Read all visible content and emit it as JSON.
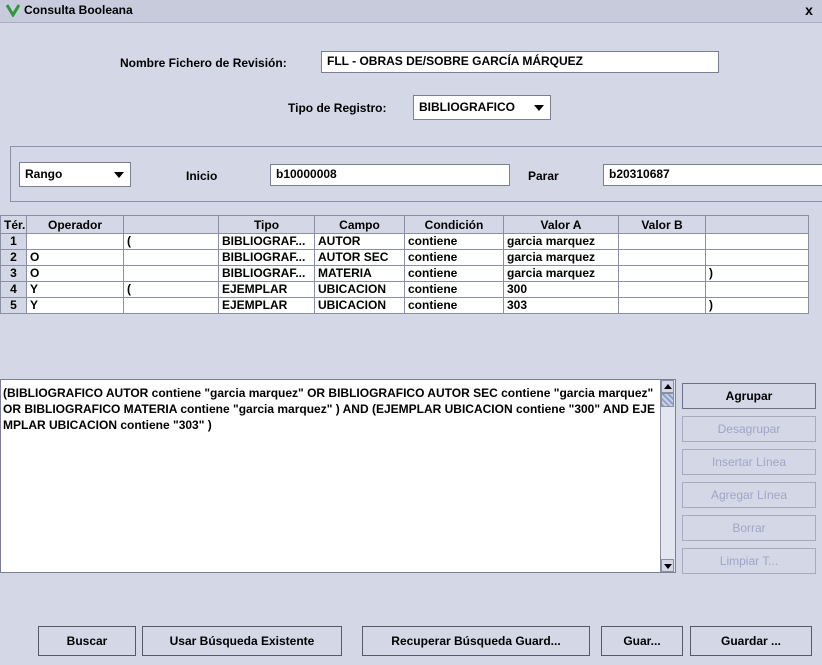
{
  "window": {
    "title": "Consulta Booleana",
    "close_symbol": "x",
    "icon": "app-check-icon"
  },
  "review_file": {
    "label": "Nombre Fichero de Revisión:",
    "value": "FLL - OBRAS DE/SOBRE GARCÍA MÁRQUEZ"
  },
  "record_type": {
    "label": "Tipo de Registro:",
    "value": "BIBLIOGRAFICO"
  },
  "range": {
    "mode": "Rango",
    "start_label": "Inicio",
    "start_value": "b10000008",
    "stop_label": "Parar",
    "stop_value": "b20310687"
  },
  "table": {
    "columns": [
      "Tér...",
      "Operador",
      "",
      "Tipo",
      "Campo",
      "Condición",
      "Valor A",
      "Valor B",
      ""
    ],
    "rows": [
      [
        "1",
        "",
        "(",
        "BIBLIOGRAF...",
        "AUTOR",
        "contiene",
        "garcia marquez",
        "",
        ""
      ],
      [
        "2",
        "O",
        "",
        "BIBLIOGRAF...",
        "AUTOR SEC",
        "contiene",
        "garcia marquez",
        "",
        ""
      ],
      [
        "3",
        "O",
        "",
        "BIBLIOGRAF...",
        "MATERIA",
        "contiene",
        "garcia marquez",
        "",
        ")"
      ],
      [
        "4",
        "Y",
        "(",
        "EJEMPLAR",
        "UBICACION",
        "contiene",
        "300",
        "",
        ""
      ],
      [
        "5",
        "Y",
        "",
        "EJEMPLAR",
        "UBICACION",
        "contiene",
        "303",
        "",
        ")"
      ]
    ]
  },
  "query_text": "(BIBLIOGRAFICO AUTOR contiene \"garcia marquez\"    OR BIBLIOGRAFICO AUTOR SEC contiene \"garcia marquez\"    OR BIBLIOGRAFICO MATERIA contiene \"garcia marquez\" )   AND (EJEMPLAR UBICACION contiene \"300\"    AND EJEMPLAR UBICACION contiene \"303\" )",
  "side_buttons": {
    "group": "Agrupar",
    "ungroup": "Desagrupar",
    "insert_line": "Insertar Línea",
    "add_line": "Agregar Línea",
    "delete": "Borrar",
    "clear": "Limpiar T..."
  },
  "bottom_buttons": {
    "search": "Buscar",
    "use_existing": "Usar Búsqueda Existente",
    "retrieve_saved": "Recuperar Búsqueda Guard...",
    "save_short": "Guar...",
    "save": "Guardar ..."
  },
  "colors": {
    "background": "#d4d7e5",
    "title_bar": "#c7cbdc",
    "disabled_text": "#9fa6c6",
    "icon_green": "#2f9a3a"
  }
}
